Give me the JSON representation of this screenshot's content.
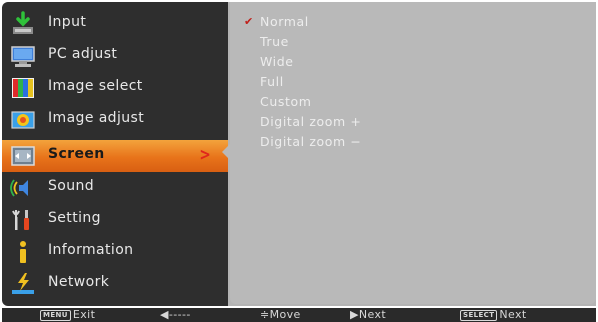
{
  "menu": {
    "items": [
      {
        "label": "Input",
        "icon": "input-icon"
      },
      {
        "label": "PC adjust",
        "icon": "pc-adjust-icon"
      },
      {
        "label": "Image select",
        "icon": "image-select-icon"
      },
      {
        "label": "Image adjust",
        "icon": "image-adjust-icon"
      },
      {
        "label": "Screen",
        "icon": "screen-icon",
        "selected": true
      },
      {
        "label": "Sound",
        "icon": "sound-icon"
      },
      {
        "label": "Setting",
        "icon": "setting-icon"
      },
      {
        "label": "Information",
        "icon": "information-icon"
      },
      {
        "label": "Network",
        "icon": "network-icon"
      }
    ],
    "selected_arrow": ">",
    "colors": {
      "panel": "#2e2e2e",
      "highlight": "#e8731a",
      "arrow": "#e0261c"
    }
  },
  "options": {
    "check_mark": "✔",
    "items": [
      {
        "label": "Normal",
        "checked": true
      },
      {
        "label": "True"
      },
      {
        "label": "Wide"
      },
      {
        "label": "Full"
      },
      {
        "label": "Custom"
      },
      {
        "label": "Digital zoom +"
      },
      {
        "label": "Digital zoom −"
      }
    ],
    "colors": {
      "panel": "#b9b9b9",
      "text": "#ededed"
    }
  },
  "footer": {
    "exit_key": "MENU",
    "exit_label": "Exit",
    "back_hint": "◀-----",
    "move_label": "≑Move",
    "next_label": "▶Next",
    "select_key": "SELECT",
    "select_label": "Next"
  }
}
